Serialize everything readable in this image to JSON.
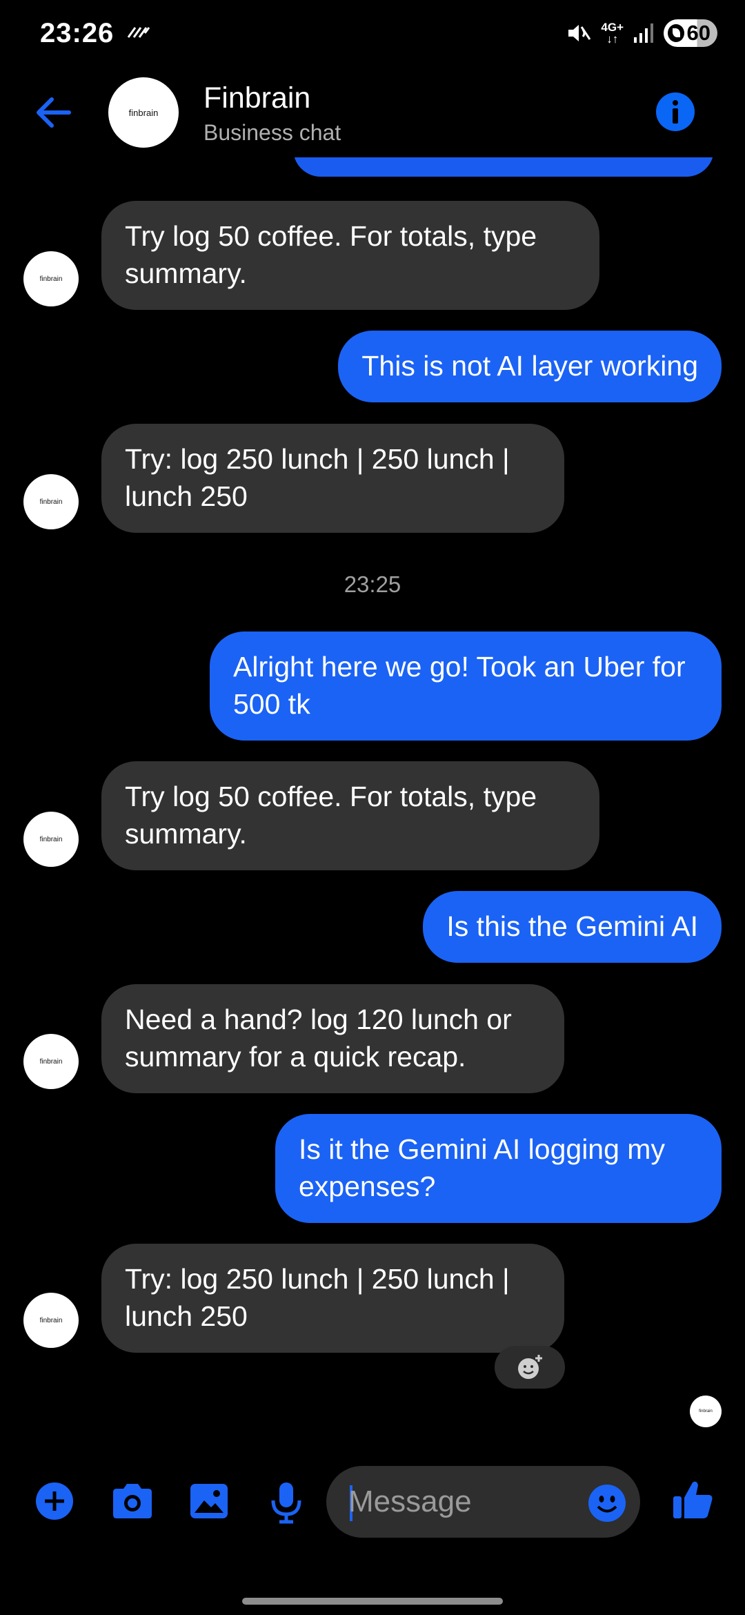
{
  "status_bar": {
    "time": "23:26",
    "network": "4G+",
    "battery": "60"
  },
  "header": {
    "avatar_text": "finbrain",
    "name": "Finbrain",
    "subtitle": "Business chat"
  },
  "messages": [
    {
      "from": "bot",
      "avatar_text": "finbrain",
      "text": "Try log 50 coffee. For totals, type summary."
    },
    {
      "from": "me",
      "text": "This is not AI layer working"
    },
    {
      "from": "bot",
      "avatar_text": "finbrain",
      "text": "Try: log 250 lunch | 250 lunch | lunch 250"
    },
    {
      "from": "me",
      "text": "Alright here we go! Took an Uber for 500 tk"
    },
    {
      "from": "bot",
      "avatar_text": "finbrain",
      "text": "Try log 50 coffee. For totals, type summary."
    },
    {
      "from": "me",
      "text": "Is this the Gemini AI"
    },
    {
      "from": "bot",
      "avatar_text": "finbrain",
      "text": "Need a hand? log 120 lunch or summary for a quick recap."
    },
    {
      "from": "me",
      "text": "Is it the Gemini AI logging my expenses?"
    },
    {
      "from": "bot",
      "avatar_text": "finbrain",
      "text": "Try: log 250 lunch | 250 lunch | lunch 250"
    }
  ],
  "timestamp": "23:25",
  "seen_avatar_text": "finbrain",
  "composer": {
    "placeholder": "Message"
  },
  "icons": {
    "back": "back-arrow-icon",
    "info": "info-icon",
    "add": "plus-circle-icon",
    "camera": "camera-icon",
    "gallery": "image-icon",
    "mic": "microphone-icon",
    "emoji": "emoji-icon",
    "like": "thumbs-up-icon",
    "react": "add-reaction-icon"
  },
  "colors": {
    "accent": "#1b63f5",
    "bot_bubble": "#333333",
    "background": "#000000"
  }
}
